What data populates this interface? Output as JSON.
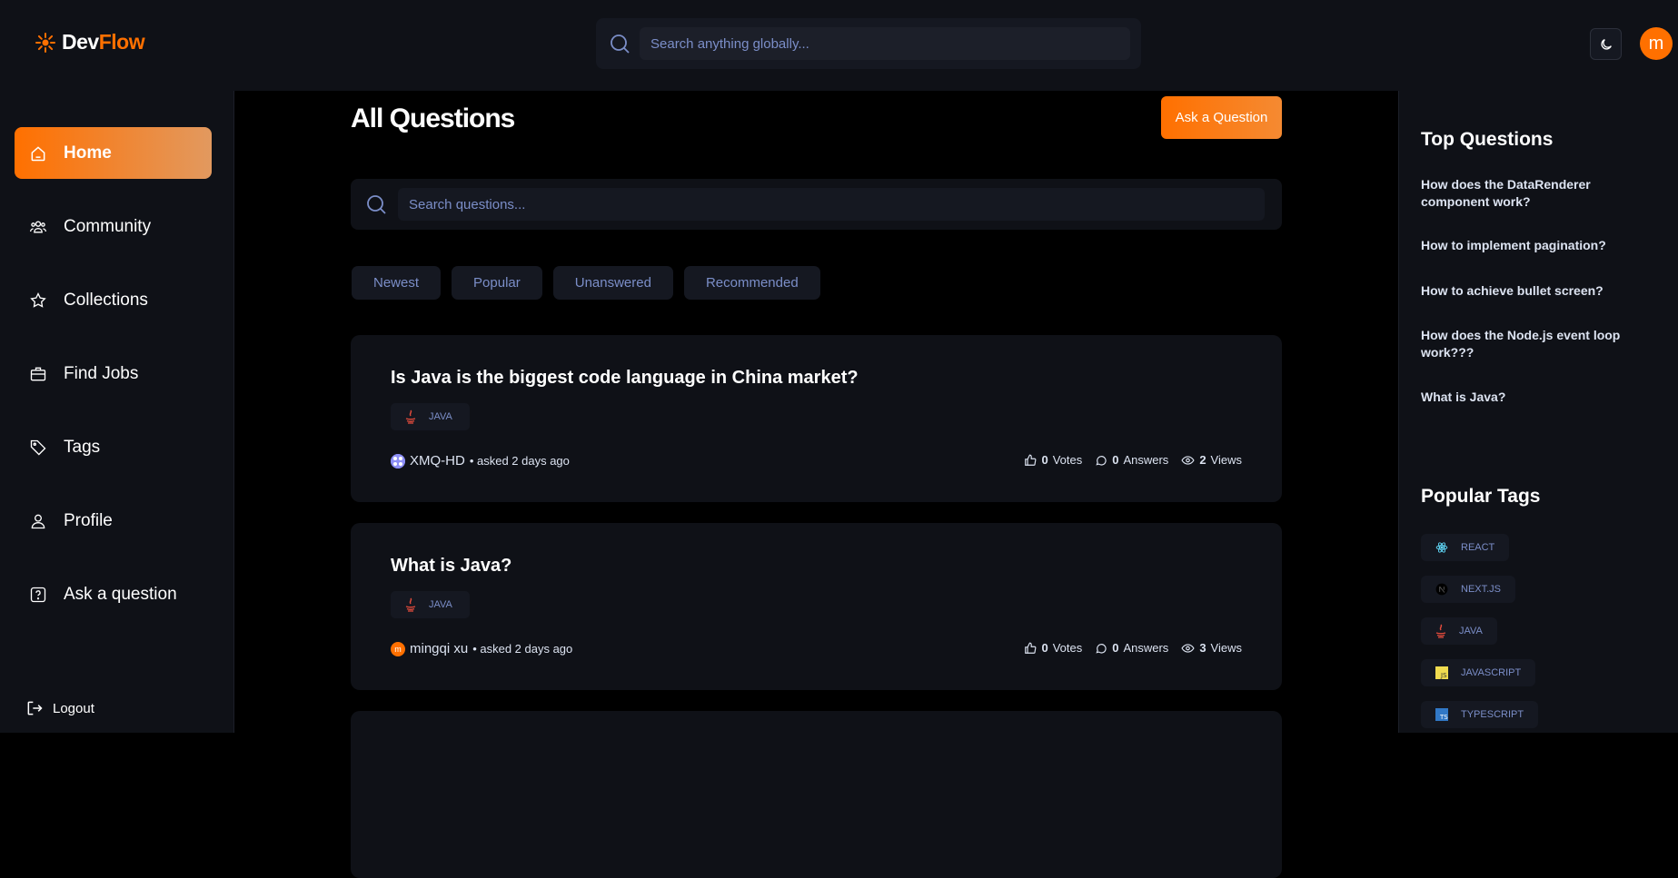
{
  "brand": {
    "name_part1": "Dev",
    "name_part2": "Flow",
    "accent": "#ff7000"
  },
  "global_search": {
    "placeholder": "Search anything globally..."
  },
  "user": {
    "initial": "m"
  },
  "sidebar": {
    "items": [
      {
        "label": "Home",
        "icon": "home-icon",
        "active": true
      },
      {
        "label": "Community",
        "icon": "users-icon"
      },
      {
        "label": "Collections",
        "icon": "star-icon"
      },
      {
        "label": "Find Jobs",
        "icon": "briefcase-icon"
      },
      {
        "label": "Tags",
        "icon": "tag-icon"
      },
      {
        "label": "Profile",
        "icon": "user-icon"
      },
      {
        "label": "Ask a question",
        "icon": "question-icon"
      }
    ],
    "logout": "Logout"
  },
  "main": {
    "title": "All Questions",
    "ask_button": "Ask a Question",
    "search_placeholder": "Search questions...",
    "filters": [
      "Newest",
      "Popular",
      "Unanswered",
      "Recommended"
    ],
    "questions": [
      {
        "title": "Is Java is the biggest code language in China market?",
        "tag": "JAVA",
        "author": "XMQ-HD",
        "asked": "• asked 2 days ago",
        "votes": "0",
        "votes_label": "Votes",
        "answers": "0",
        "answers_label": "Answers",
        "views": "2",
        "views_label": "Views"
      },
      {
        "title": "What is Java?",
        "tag": "JAVA",
        "author": "mingqi xu",
        "author_initial": "m",
        "asked": "• asked 2 days ago",
        "votes": "0",
        "votes_label": "Votes",
        "answers": "0",
        "answers_label": "Answers",
        "views": "3",
        "views_label": "Views"
      }
    ]
  },
  "rightbar": {
    "top_questions_title": "Top Questions",
    "top_questions": [
      "How does the DataRenderer component work?",
      "How to implement pagination?",
      "How to achieve bullet screen?",
      "How does the Node.js event loop work???",
      "What is Java?"
    ],
    "popular_tags_title": "Popular Tags",
    "popular_tags": [
      "REACT",
      "NEXT.JS",
      "JAVA",
      "JAVASCRIPT",
      "TYPESCRIPT"
    ]
  }
}
